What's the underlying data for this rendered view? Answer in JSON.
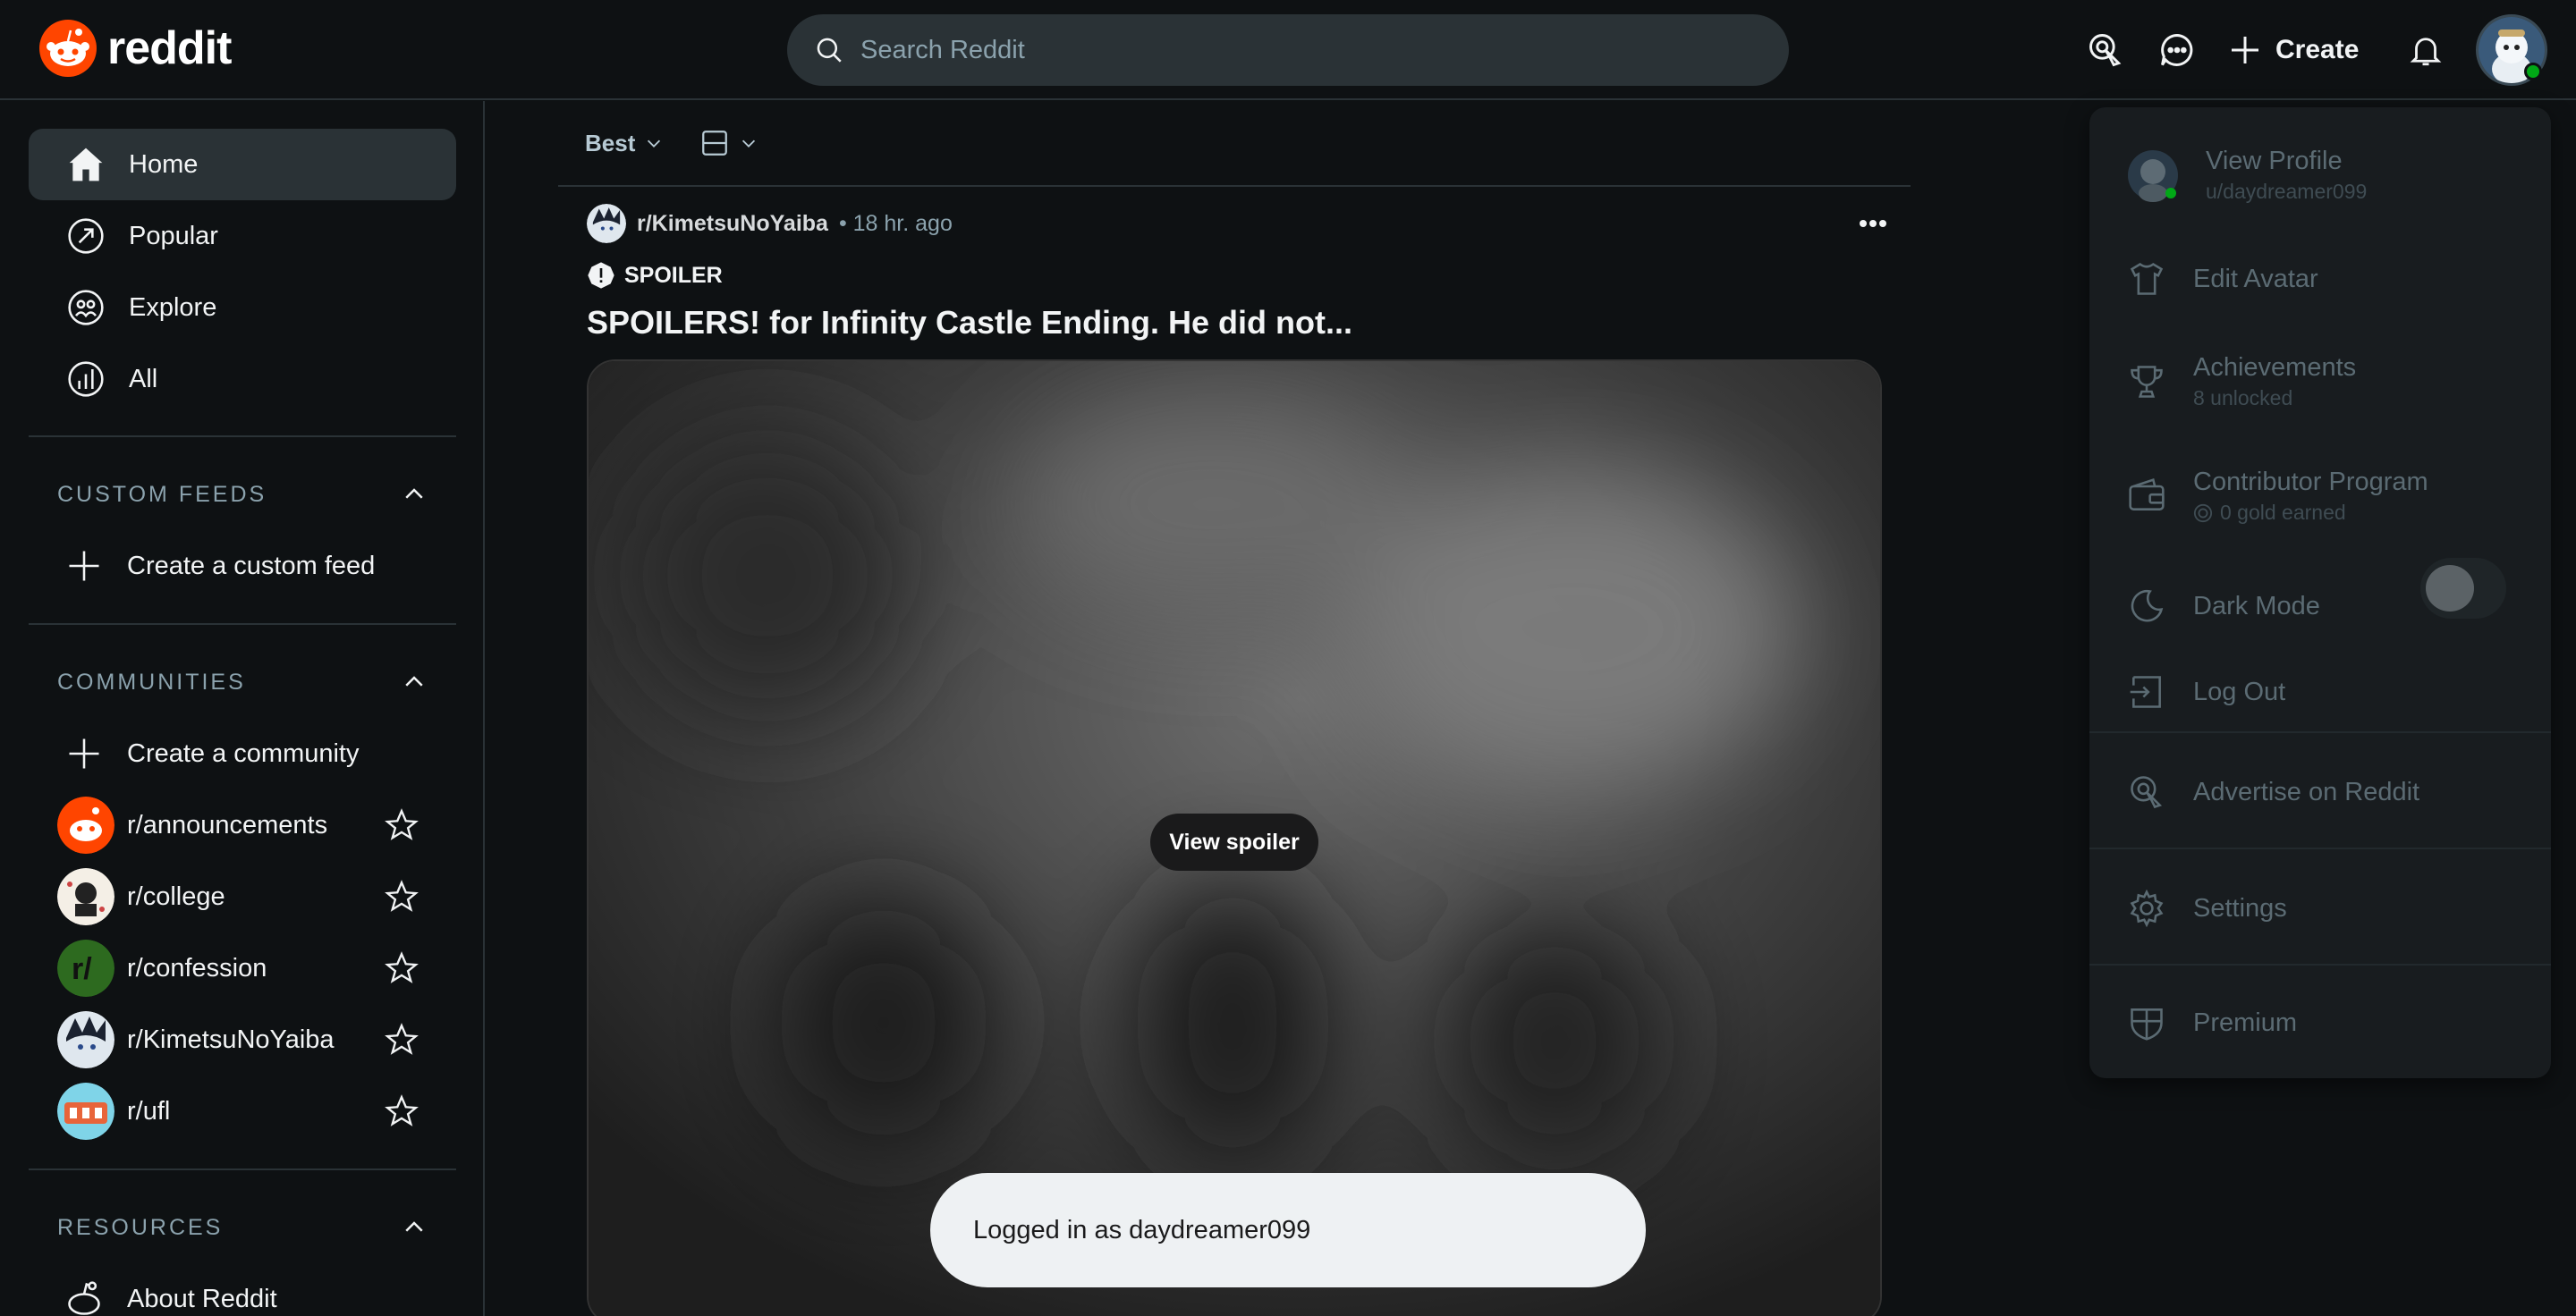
{
  "header": {
    "logo_text": "reddit",
    "search_placeholder": "Search Reddit",
    "create_label": "Create",
    "icons": [
      "advertise-icon",
      "chat-icon",
      "plus-icon",
      "bell-icon"
    ]
  },
  "sidebar": {
    "nav": [
      {
        "label": "Home",
        "icon": "home-icon",
        "active": true
      },
      {
        "label": "Popular",
        "icon": "popular-icon"
      },
      {
        "label": "Explore",
        "icon": "explore-icon"
      },
      {
        "label": "All",
        "icon": "all-icon"
      }
    ],
    "custom_feeds": {
      "title": "CUSTOM FEEDS",
      "create_label": "Create a custom feed"
    },
    "communities": {
      "title": "COMMUNITIES",
      "create_label": "Create a community",
      "items": [
        {
          "label": "r/announcements"
        },
        {
          "label": "r/college"
        },
        {
          "label": "r/confession"
        },
        {
          "label": "r/KimetsuNoYaiba"
        },
        {
          "label": "r/ufl"
        }
      ]
    },
    "resources": {
      "title": "RESOURCES",
      "about_label": "About Reddit"
    }
  },
  "feed": {
    "sort_label": "Best",
    "post": {
      "subreddit": "r/KimetsuNoYaiba",
      "time": "• 18 hr. ago",
      "tag": "SPOILER",
      "title": "SPOILERS! for Infinity Castle Ending. He did not...",
      "spoiler_button": "View spoiler"
    }
  },
  "user_menu": {
    "view_profile": "View Profile",
    "username": "u/daydreamer099",
    "edit_avatar": "Edit Avatar",
    "achievements": "Achievements",
    "achievements_sub": "8 unlocked",
    "contributor": "Contributor Program",
    "contributor_sub": "0 gold earned",
    "dark_mode": "Dark Mode",
    "log_out": "Log Out",
    "advertise": "Advertise on Reddit",
    "settings": "Settings",
    "premium": "Premium"
  },
  "toast": {
    "message": "Logged in as daydreamer099"
  },
  "colors": {
    "brand": "#ff4500",
    "background": "#0e1113",
    "surface": "#2a3236"
  }
}
